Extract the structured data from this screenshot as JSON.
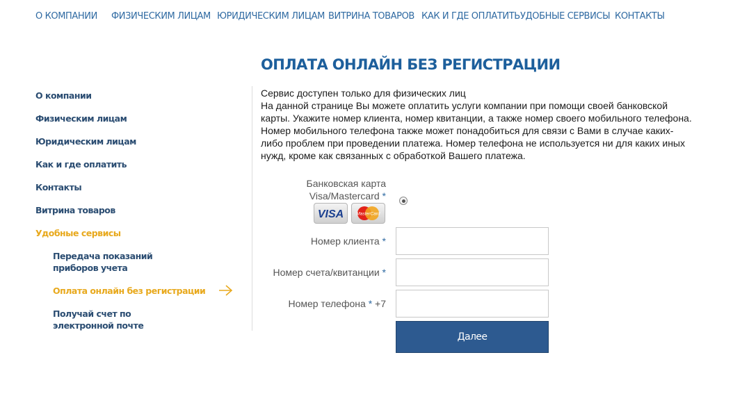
{
  "top_nav": [
    {
      "label": "О КОМПАНИИ"
    },
    {
      "label": "ФИЗИЧЕСКИМ ЛИЦАМ"
    },
    {
      "label": "ЮРИДИЧЕСКИМ ЛИЦАМ"
    },
    {
      "label": "ВИТРИНА ТОВАРОВ"
    },
    {
      "label": "КАК И ГДЕ ОПЛАТИТЬ"
    },
    {
      "label": "УДОБНЫЕ СЕРВИСЫ"
    },
    {
      "label": "КОНТАКТЫ"
    }
  ],
  "page_title": "ОПЛАТА ОНЛАЙН БЕЗ РЕГИСТРАЦИИ",
  "sidebar": {
    "items": [
      {
        "label": "О компании"
      },
      {
        "label": "Физическим лицам"
      },
      {
        "label": "Юридическим лицам"
      },
      {
        "label": "Как и где оплатить"
      },
      {
        "label": "Контакты"
      },
      {
        "label": "Витрина товаров"
      },
      {
        "label": "Удобные сервисы",
        "active": true
      }
    ],
    "sub_items": [
      {
        "label": "Передача показаний приборов учета"
      },
      {
        "label": "Оплата онлайн без регистрации",
        "active": true
      },
      {
        "label": "Получай счет по электронной почте"
      }
    ]
  },
  "intro": {
    "line1": "Сервис доступен только для физических лиц",
    "body": "На данной странице Вы можете оплатить услуги компании при помощи своей банковской карты. Укажите номер клиента, номер квитанции, а также номер своего мобильного телефона. Номер мобильного телефона также может понадобиться для связи с Вами в случае каких-либо проблем при проведении платежа. Номер телефона не используется ни для каких иных нужд, кроме как связанных с обработкой Вашего платежа."
  },
  "form": {
    "card_label_line1": "Банковская карта",
    "card_label_line2": "Visa/Mastercard",
    "required_mark": "*",
    "card_selected": true,
    "client_number_label": "Номер клиента",
    "account_label": "Номер счета/квитанции",
    "phone_label": "Номер телефона",
    "phone_prefix": "+7",
    "submit_label": "Далее"
  },
  "icons": {
    "visa": "visa-card-icon",
    "mastercard": "mastercard-icon",
    "active_arrow": "arrow-right-icon"
  },
  "colors": {
    "link": "#2f6aa2",
    "title": "#1d5f9c",
    "active": "#e8a91d",
    "button": "#2d5a90"
  }
}
